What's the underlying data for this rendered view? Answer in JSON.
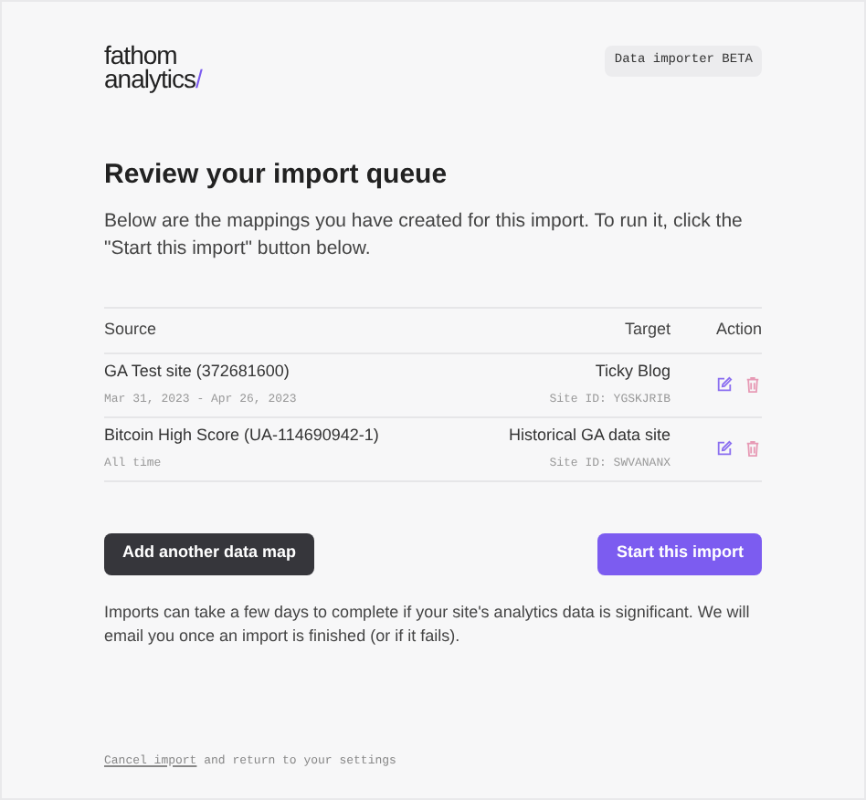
{
  "logo": {
    "line1": "fathom",
    "line2": "analytics",
    "mark": "/"
  },
  "badge": "Data importer BETA",
  "title": "Review your import queue",
  "intro": "Below are the mappings you have created for this import. To run it, click the \"Start this import\" button below.",
  "table": {
    "columns": [
      "Source",
      "Target",
      "Action"
    ],
    "rows": [
      {
        "source": "GA Test site (372681600)",
        "source_detail": "Mar 31, 2023 - Apr 26, 2023",
        "target": "Ticky Blog",
        "target_detail": "Site ID: YGSKJRIB"
      },
      {
        "source": "Bitcoin High Score (UA-114690942-1)",
        "source_detail": "All time",
        "target": "Historical GA data site",
        "target_detail": "Site ID: SWVANANX"
      }
    ]
  },
  "buttons": {
    "secondary": "Add another data map",
    "primary": "Start this import"
  },
  "note": "Imports can take a few days to complete if your site's analytics data is significant. We will email you once an import is finished (or if it fails).",
  "footer": {
    "link": "Cancel import",
    "text": " and return to your settings"
  }
}
